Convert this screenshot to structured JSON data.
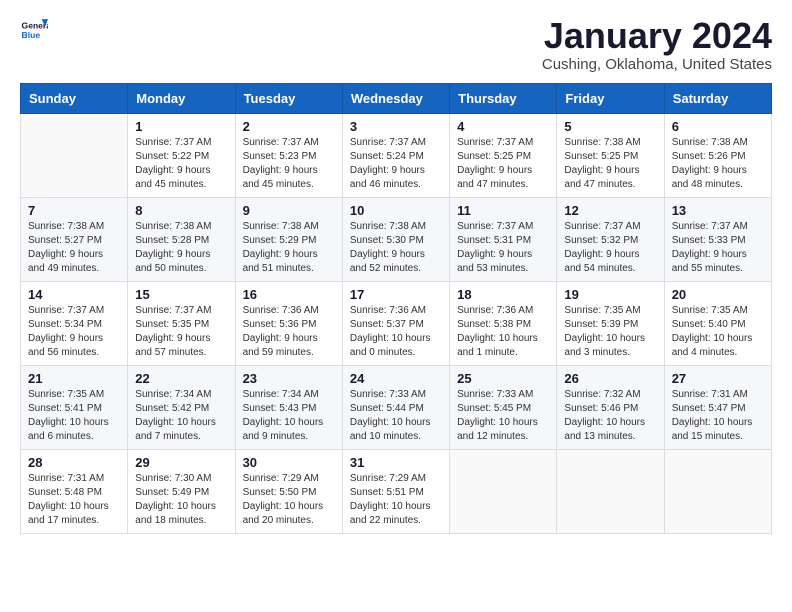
{
  "header": {
    "logo_line1": "General",
    "logo_line2": "Blue",
    "title": "January 2024",
    "subtitle": "Cushing, Oklahoma, United States"
  },
  "columns": [
    "Sunday",
    "Monday",
    "Tuesday",
    "Wednesday",
    "Thursday",
    "Friday",
    "Saturday"
  ],
  "weeks": [
    [
      {
        "day": "",
        "sunrise": "",
        "sunset": "",
        "daylight": ""
      },
      {
        "day": "1",
        "sunrise": "Sunrise: 7:37 AM",
        "sunset": "Sunset: 5:22 PM",
        "daylight": "Daylight: 9 hours and 45 minutes."
      },
      {
        "day": "2",
        "sunrise": "Sunrise: 7:37 AM",
        "sunset": "Sunset: 5:23 PM",
        "daylight": "Daylight: 9 hours and 45 minutes."
      },
      {
        "day": "3",
        "sunrise": "Sunrise: 7:37 AM",
        "sunset": "Sunset: 5:24 PM",
        "daylight": "Daylight: 9 hours and 46 minutes."
      },
      {
        "day": "4",
        "sunrise": "Sunrise: 7:37 AM",
        "sunset": "Sunset: 5:25 PM",
        "daylight": "Daylight: 9 hours and 47 minutes."
      },
      {
        "day": "5",
        "sunrise": "Sunrise: 7:38 AM",
        "sunset": "Sunset: 5:25 PM",
        "daylight": "Daylight: 9 hours and 47 minutes."
      },
      {
        "day": "6",
        "sunrise": "Sunrise: 7:38 AM",
        "sunset": "Sunset: 5:26 PM",
        "daylight": "Daylight: 9 hours and 48 minutes."
      }
    ],
    [
      {
        "day": "7",
        "sunrise": "Sunrise: 7:38 AM",
        "sunset": "Sunset: 5:27 PM",
        "daylight": "Daylight: 9 hours and 49 minutes."
      },
      {
        "day": "8",
        "sunrise": "Sunrise: 7:38 AM",
        "sunset": "Sunset: 5:28 PM",
        "daylight": "Daylight: 9 hours and 50 minutes."
      },
      {
        "day": "9",
        "sunrise": "Sunrise: 7:38 AM",
        "sunset": "Sunset: 5:29 PM",
        "daylight": "Daylight: 9 hours and 51 minutes."
      },
      {
        "day": "10",
        "sunrise": "Sunrise: 7:38 AM",
        "sunset": "Sunset: 5:30 PM",
        "daylight": "Daylight: 9 hours and 52 minutes."
      },
      {
        "day": "11",
        "sunrise": "Sunrise: 7:37 AM",
        "sunset": "Sunset: 5:31 PM",
        "daylight": "Daylight: 9 hours and 53 minutes."
      },
      {
        "day": "12",
        "sunrise": "Sunrise: 7:37 AM",
        "sunset": "Sunset: 5:32 PM",
        "daylight": "Daylight: 9 hours and 54 minutes."
      },
      {
        "day": "13",
        "sunrise": "Sunrise: 7:37 AM",
        "sunset": "Sunset: 5:33 PM",
        "daylight": "Daylight: 9 hours and 55 minutes."
      }
    ],
    [
      {
        "day": "14",
        "sunrise": "Sunrise: 7:37 AM",
        "sunset": "Sunset: 5:34 PM",
        "daylight": "Daylight: 9 hours and 56 minutes."
      },
      {
        "day": "15",
        "sunrise": "Sunrise: 7:37 AM",
        "sunset": "Sunset: 5:35 PM",
        "daylight": "Daylight: 9 hours and 57 minutes."
      },
      {
        "day": "16",
        "sunrise": "Sunrise: 7:36 AM",
        "sunset": "Sunset: 5:36 PM",
        "daylight": "Daylight: 9 hours and 59 minutes."
      },
      {
        "day": "17",
        "sunrise": "Sunrise: 7:36 AM",
        "sunset": "Sunset: 5:37 PM",
        "daylight": "Daylight: 10 hours and 0 minutes."
      },
      {
        "day": "18",
        "sunrise": "Sunrise: 7:36 AM",
        "sunset": "Sunset: 5:38 PM",
        "daylight": "Daylight: 10 hours and 1 minute."
      },
      {
        "day": "19",
        "sunrise": "Sunrise: 7:35 AM",
        "sunset": "Sunset: 5:39 PM",
        "daylight": "Daylight: 10 hours and 3 minutes."
      },
      {
        "day": "20",
        "sunrise": "Sunrise: 7:35 AM",
        "sunset": "Sunset: 5:40 PM",
        "daylight": "Daylight: 10 hours and 4 minutes."
      }
    ],
    [
      {
        "day": "21",
        "sunrise": "Sunrise: 7:35 AM",
        "sunset": "Sunset: 5:41 PM",
        "daylight": "Daylight: 10 hours and 6 minutes."
      },
      {
        "day": "22",
        "sunrise": "Sunrise: 7:34 AM",
        "sunset": "Sunset: 5:42 PM",
        "daylight": "Daylight: 10 hours and 7 minutes."
      },
      {
        "day": "23",
        "sunrise": "Sunrise: 7:34 AM",
        "sunset": "Sunset: 5:43 PM",
        "daylight": "Daylight: 10 hours and 9 minutes."
      },
      {
        "day": "24",
        "sunrise": "Sunrise: 7:33 AM",
        "sunset": "Sunset: 5:44 PM",
        "daylight": "Daylight: 10 hours and 10 minutes."
      },
      {
        "day": "25",
        "sunrise": "Sunrise: 7:33 AM",
        "sunset": "Sunset: 5:45 PM",
        "daylight": "Daylight: 10 hours and 12 minutes."
      },
      {
        "day": "26",
        "sunrise": "Sunrise: 7:32 AM",
        "sunset": "Sunset: 5:46 PM",
        "daylight": "Daylight: 10 hours and 13 minutes."
      },
      {
        "day": "27",
        "sunrise": "Sunrise: 7:31 AM",
        "sunset": "Sunset: 5:47 PM",
        "daylight": "Daylight: 10 hours and 15 minutes."
      }
    ],
    [
      {
        "day": "28",
        "sunrise": "Sunrise: 7:31 AM",
        "sunset": "Sunset: 5:48 PM",
        "daylight": "Daylight: 10 hours and 17 minutes."
      },
      {
        "day": "29",
        "sunrise": "Sunrise: 7:30 AM",
        "sunset": "Sunset: 5:49 PM",
        "daylight": "Daylight: 10 hours and 18 minutes."
      },
      {
        "day": "30",
        "sunrise": "Sunrise: 7:29 AM",
        "sunset": "Sunset: 5:50 PM",
        "daylight": "Daylight: 10 hours and 20 minutes."
      },
      {
        "day": "31",
        "sunrise": "Sunrise: 7:29 AM",
        "sunset": "Sunset: 5:51 PM",
        "daylight": "Daylight: 10 hours and 22 minutes."
      },
      {
        "day": "",
        "sunrise": "",
        "sunset": "",
        "daylight": ""
      },
      {
        "day": "",
        "sunrise": "",
        "sunset": "",
        "daylight": ""
      },
      {
        "day": "",
        "sunrise": "",
        "sunset": "",
        "daylight": ""
      }
    ]
  ]
}
